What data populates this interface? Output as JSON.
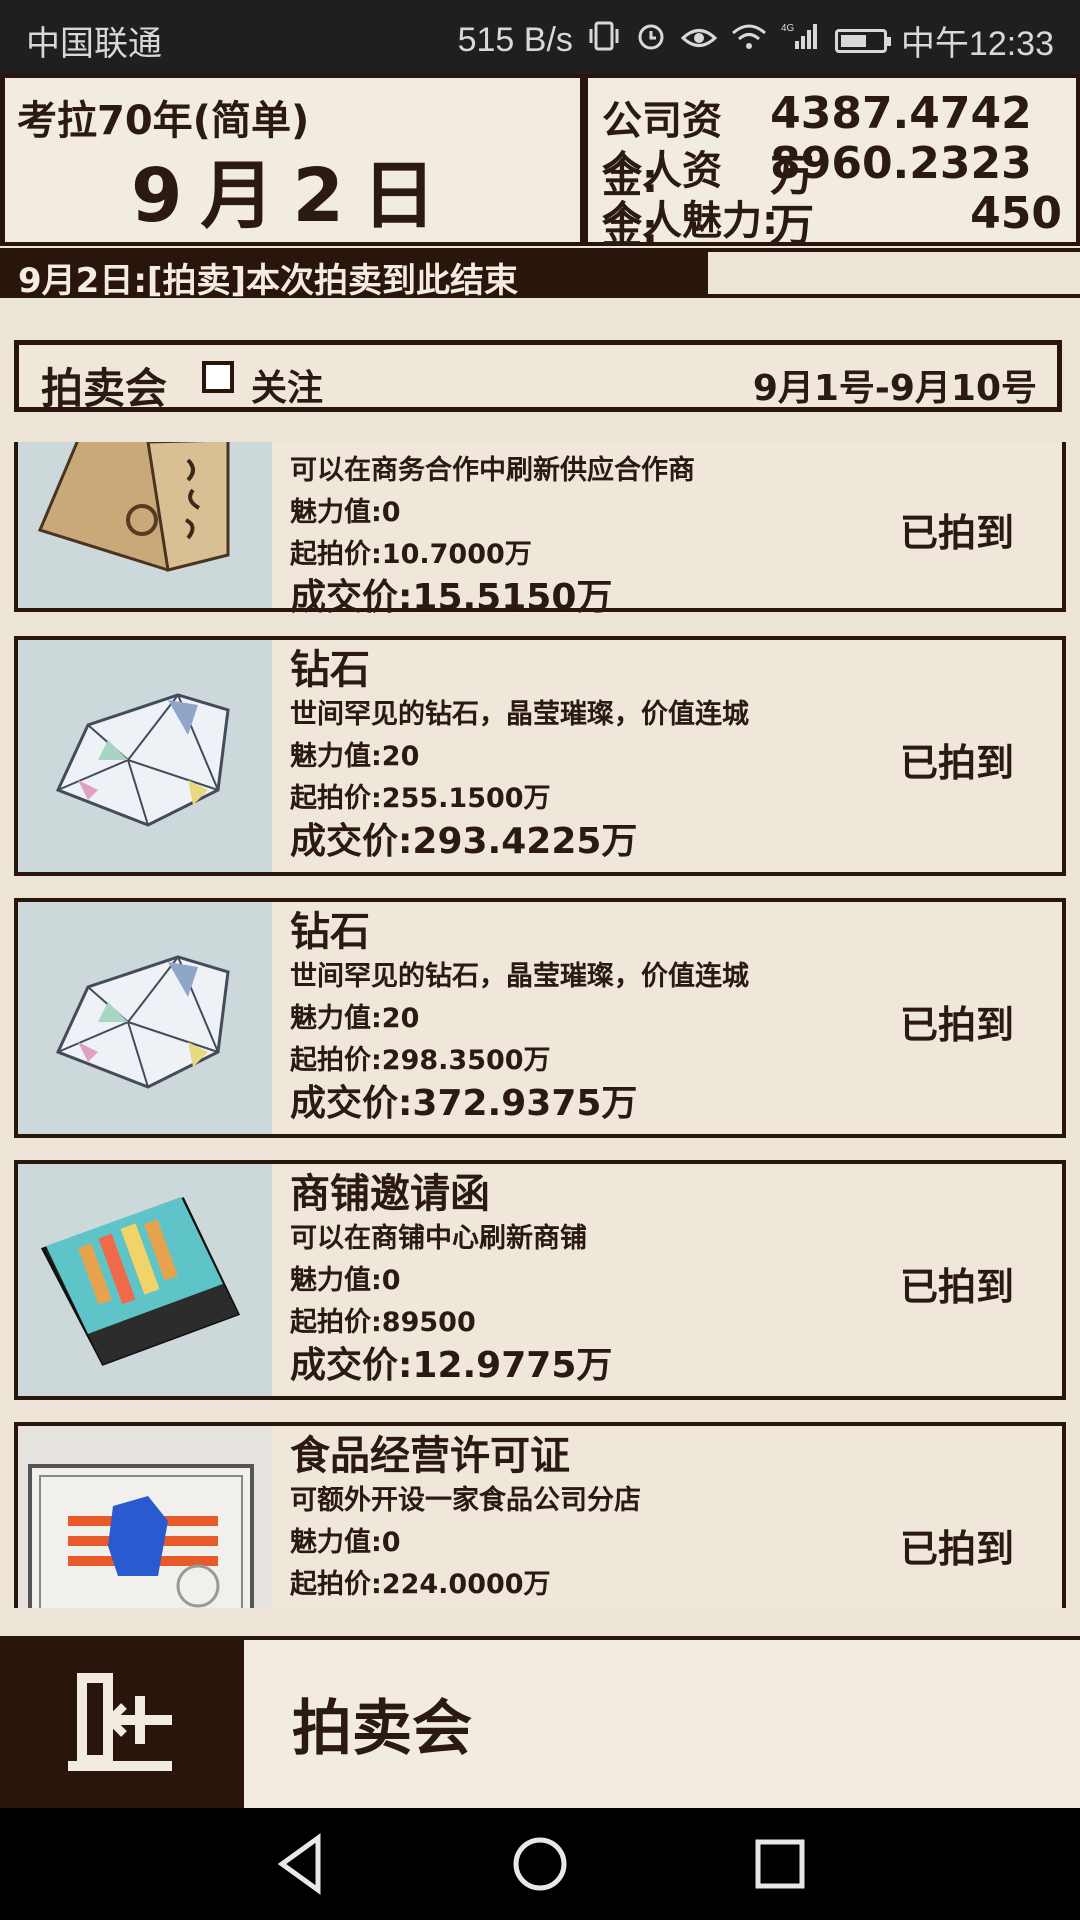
{
  "status_bar": {
    "carrier": "中国联通",
    "net_speed": "515 B/s",
    "network": "4G",
    "time": "中午12:33"
  },
  "header": {
    "mode": "考拉70年(简单)",
    "date": "9月2日",
    "funds": [
      {
        "label": "公司资金:",
        "value": "4387.4742万"
      },
      {
        "label": "个人资金:",
        "value": "8960.2323万"
      },
      {
        "label": "个人魅力:",
        "value": "450"
      }
    ]
  },
  "news": {
    "text": "9月2日:[拍卖]本次拍卖到此结束"
  },
  "auction": {
    "title": "拍卖会",
    "follow_label": "关注",
    "follow_checked": false,
    "date_range": "9月1号-9月10号"
  },
  "items": [
    {
      "name": "",
      "desc": "可以在商务合作中刷新供应合作商",
      "charm": "魅力值:0",
      "start_price": "起拍价:10.7000万",
      "final_price": "成交价:15.5150万",
      "status": "已拍到",
      "icon": "invitation-letter-icon"
    },
    {
      "name": "钻石",
      "desc": "世间罕见的钻石，晶莹璀璨，价值连城",
      "charm": "魅力值:20",
      "start_price": "起拍价:255.1500万",
      "final_price": "成交价:293.4225万",
      "status": "已拍到",
      "icon": "diamond-icon"
    },
    {
      "name": "钻石",
      "desc": "世间罕见的钻石，晶莹璀璨，价值连城",
      "charm": "魅力值:20",
      "start_price": "起拍价:298.3500万",
      "final_price": "成交价:372.9375万",
      "status": "已拍到",
      "icon": "diamond-icon"
    },
    {
      "name": "商铺邀请函",
      "desc": "可以在商铺中心刷新商铺",
      "charm": "魅力值:0",
      "start_price": "起拍价:89500",
      "final_price": "成交价:12.9775万",
      "status": "已拍到",
      "icon": "shop-invitation-icon"
    },
    {
      "name": "食品经营许可证",
      "desc": "可额外开设一家食品公司分店",
      "charm": "魅力值:0",
      "start_price": "起拍价:224.0000万",
      "final_price": "",
      "status": "已拍到",
      "icon": "food-license-icon"
    }
  ],
  "bottom": {
    "title": "拍卖会"
  },
  "colors": {
    "dark_brown": "#2a150c",
    "paper": "#ece4d6",
    "thumb_bg": "#cdd8da"
  }
}
